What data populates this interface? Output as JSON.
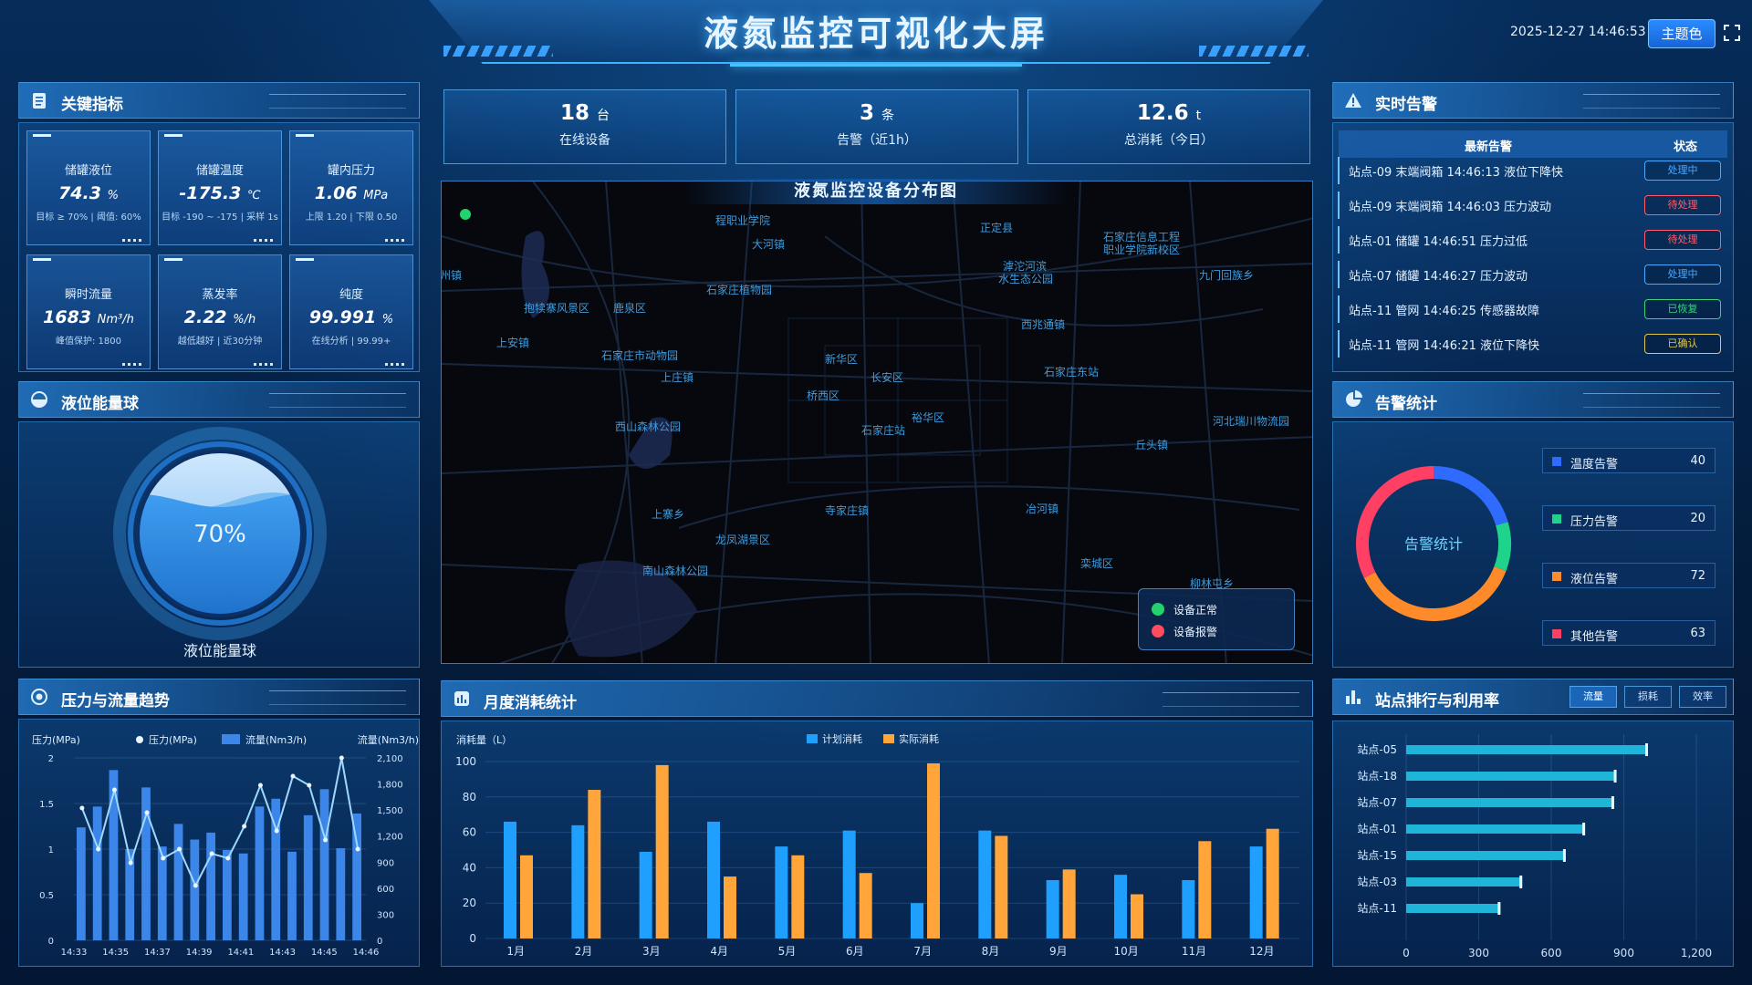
{
  "header": {
    "title": "液氮监控可视化大屏",
    "datetime": "2025-12-27 14:46:53",
    "theme_button": "主题色",
    "fullscreen_icon": "fullscreen-icon"
  },
  "panels": {
    "key_metrics": "关键指标",
    "level_ball": "液位能量球",
    "trend": "压力与流量趋势",
    "map": "液氮监控设备分布图",
    "monthly": "月度消耗统计",
    "alarms": "实时告警",
    "alarm_stats": "告警统计",
    "ranking": "站点排行与利用率"
  },
  "kpis": [
    {
      "label": "储罐液位",
      "value": "74.3",
      "unit": "%",
      "sub": "目标 ≥ 70% | 阈值: 60%"
    },
    {
      "label": "储罐温度",
      "value": "-175.3",
      "unit": "℃",
      "sub": "目标 -190 ~ -175 | 采样 1s"
    },
    {
      "label": "罐内压力",
      "value": "1.06",
      "unit": "MPa",
      "sub": "上限 1.20 | 下限 0.50"
    },
    {
      "label": "瞬时流量",
      "value": "1683",
      "unit": "Nm³/h",
      "sub": "峰值保护: 1800"
    },
    {
      "label": "蒸发率",
      "value": "2.22",
      "unit": "%/h",
      "sub": "越低越好 | 近30分钟"
    },
    {
      "label": "纯度",
      "value": "99.991",
      "unit": "%",
      "sub": "在线分析 | 99.99+"
    }
  ],
  "stats": [
    {
      "value": "18",
      "unit": "台",
      "label": "在线设备"
    },
    {
      "value": "3",
      "unit": "条",
      "label": "告警（近1h）"
    },
    {
      "value": "12.6",
      "unit": "t",
      "label": "总消耗（今日）"
    }
  ],
  "level_ball": {
    "percent": "70%",
    "fill": 0.7,
    "caption": "液位能量球"
  },
  "map": {
    "labels": [
      {
        "text": "程职业学院"
      },
      {
        "text": "正定县"
      },
      {
        "text": "大河镇"
      },
      {
        "text": "石家庄信息工程"
      },
      {
        "text": "职业学院新校区"
      },
      {
        "text": "滹沱河滨"
      },
      {
        "text": "水生态公园"
      },
      {
        "text": "九门回族乡"
      },
      {
        "text": "石家庄植物园"
      },
      {
        "text": "抱犊寨风景区"
      },
      {
        "text": "鹿泉区"
      },
      {
        "text": "西兆通镇"
      },
      {
        "text": "上安镇"
      },
      {
        "text": "石家庄市动物园"
      },
      {
        "text": "新华区"
      },
      {
        "text": "上庄镇"
      },
      {
        "text": "长安区"
      },
      {
        "text": "石家庄东站"
      },
      {
        "text": "桥西区"
      },
      {
        "text": "裕华区"
      },
      {
        "text": "西山森林公园"
      },
      {
        "text": "石家庄站"
      },
      {
        "text": "河北瑞川物流园"
      },
      {
        "text": "丘头镇"
      },
      {
        "text": "寺家庄镇"
      },
      {
        "text": "上寨乡"
      },
      {
        "text": "冶河镇"
      },
      {
        "text": "龙凤湖景区"
      },
      {
        "text": "南山森林公园"
      },
      {
        "text": "栾城区"
      },
      {
        "text": "柳林屯乡"
      },
      {
        "text": "州镇"
      }
    ],
    "legend": [
      {
        "label": "设备正常",
        "color": "#22d36b"
      },
      {
        "label": "设备报警",
        "color": "#ff4d5e"
      }
    ]
  },
  "alarms": {
    "header_latest": "最新告警",
    "header_status": "状态",
    "rows": [
      {
        "text": "站点-09 末端阀箱 14:46:13 液位下降快",
        "status": "处理中",
        "color": "#4aa8ff"
      },
      {
        "text": "站点-09 末端阀箱 14:46:03 压力波动",
        "status": "待处理",
        "color": "#ff5d6e"
      },
      {
        "text": "站点-01 储罐 14:46:51 压力过低",
        "status": "待处理",
        "color": "#ff5d6e"
      },
      {
        "text": "站点-07 储罐 14:46:27 压力波动",
        "status": "处理中",
        "color": "#4aa8ff"
      },
      {
        "text": "站点-11 管网 14:46:25 传感器故障",
        "status": "已恢复",
        "color": "#3bd37a"
      },
      {
        "text": "站点-11 管网 14:46:21 液位下降快",
        "status": "已确认",
        "color": "#e3c74a"
      }
    ]
  },
  "alarm_stats": {
    "center_label": "告警统计",
    "items": [
      {
        "label": "温度告警",
        "value": 40,
        "color": "#2f6bff"
      },
      {
        "label": "压力告警",
        "value": 20,
        "color": "#1fd38a"
      },
      {
        "label": "液位告警",
        "value": 72,
        "color": "#ff8a2a"
      },
      {
        "label": "其他告警",
        "value": 63,
        "color": "#ff3f63"
      }
    ]
  },
  "ranking_tabs": [
    "流量",
    "损耗",
    "效率"
  ],
  "chart_data": [
    {
      "type": "bar",
      "id": "trend",
      "legend": [
        "压力(MPa)",
        "流量(Nm3/h)"
      ],
      "ylabel_left": "压力(MPa)",
      "ylabel_right": "流量(Nm3/h)",
      "y_left_ticks": [
        "0",
        "0.5",
        "1",
        "1.5",
        "2"
      ],
      "y_right_ticks": [
        "0",
        "300",
        "600",
        "900",
        "1,200",
        "1,500",
        "1,800",
        "2,100"
      ],
      "x_ticks": [
        "14:33",
        "14:35",
        "14:37",
        "14:39",
        "14:41",
        "14:43",
        "14:45",
        "14:46"
      ],
      "ylim_left": [
        0,
        2
      ],
      "ylim_right": [
        0,
        2100
      ],
      "flow": [
        1300,
        1540,
        1960,
        1050,
        1760,
        1080,
        1340,
        1160,
        1240,
        1040,
        1000,
        1540,
        1630,
        1020,
        1440,
        1740,
        1060,
        1460
      ],
      "pressure": [
        1.45,
        1.0,
        1.65,
        0.85,
        1.4,
        0.9,
        1.0,
        0.6,
        0.95,
        0.9,
        1.25,
        1.7,
        1.2,
        1.8,
        1.7,
        1.1,
        2.0,
        1.0
      ]
    },
    {
      "type": "bar",
      "id": "monthly",
      "ylabel": "消耗量（L）",
      "categories": [
        "1月",
        "2月",
        "3月",
        "4月",
        "5月",
        "6月",
        "7月",
        "8月",
        "9月",
        "10月",
        "11月",
        "12月"
      ],
      "ylim": [
        0,
        100
      ],
      "y_ticks": [
        "0",
        "20",
        "40",
        "60",
        "80",
        "100"
      ],
      "series": [
        {
          "name": "计划消耗",
          "color": "#1fa0ff",
          "values": [
            66,
            64,
            49,
            66,
            52,
            61,
            20,
            61,
            33,
            36,
            33,
            52
          ]
        },
        {
          "name": "实际消耗",
          "color": "#ffa53a",
          "values": [
            47,
            84,
            98,
            35,
            47,
            37,
            99,
            58,
            39,
            25,
            55,
            62
          ]
        }
      ]
    },
    {
      "type": "bar",
      "id": "ranking",
      "orientation": "horizontal",
      "categories": [
        "站点-05",
        "站点-18",
        "站点-07",
        "站点-01",
        "站点-15",
        "站点-03",
        "站点-11"
      ],
      "values": [
        1000,
        870,
        860,
        740,
        660,
        480,
        390
      ],
      "xlim": [
        0,
        1200
      ],
      "x_ticks": [
        "0",
        "300",
        "600",
        "900",
        "1,200"
      ]
    }
  ]
}
